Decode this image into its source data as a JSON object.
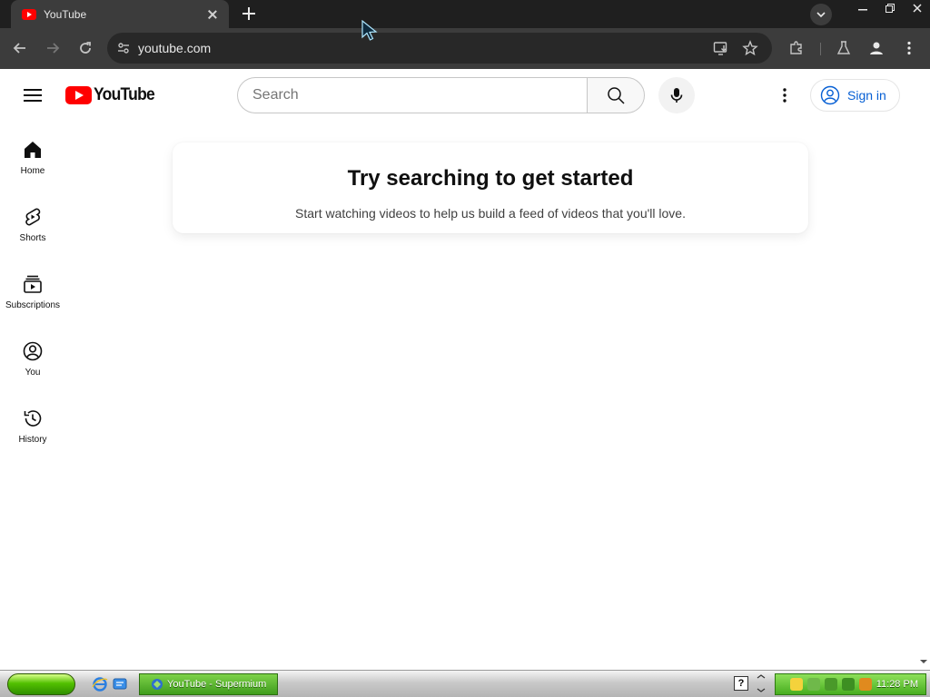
{
  "browser": {
    "tab": {
      "title": "YouTube"
    },
    "url": "youtube.com"
  },
  "youtube": {
    "logo_text": "YouTube",
    "search": {
      "placeholder": "Search"
    },
    "sign_in_label": "Sign in",
    "guide": [
      {
        "label": "Home",
        "icon": "home-icon"
      },
      {
        "label": "Shorts",
        "icon": "shorts-icon"
      },
      {
        "label": "Subscriptions",
        "icon": "subscriptions-icon"
      },
      {
        "label": "You",
        "icon": "you-icon"
      },
      {
        "label": "History",
        "icon": "history-icon"
      }
    ],
    "promo": {
      "title": "Try searching to get started",
      "body": "Start watching videos to help us build a feed of videos that you'll love."
    }
  },
  "taskbar": {
    "task_label": "YouTube - Supermium",
    "clock": "11:28 PM",
    "help_glyph": "?"
  },
  "colors": {
    "youtube_red": "#ff0000",
    "link_blue": "#065fd4",
    "chrome_dark": "#1f1f1f",
    "chrome_toolbar": "#3c3c3c"
  }
}
